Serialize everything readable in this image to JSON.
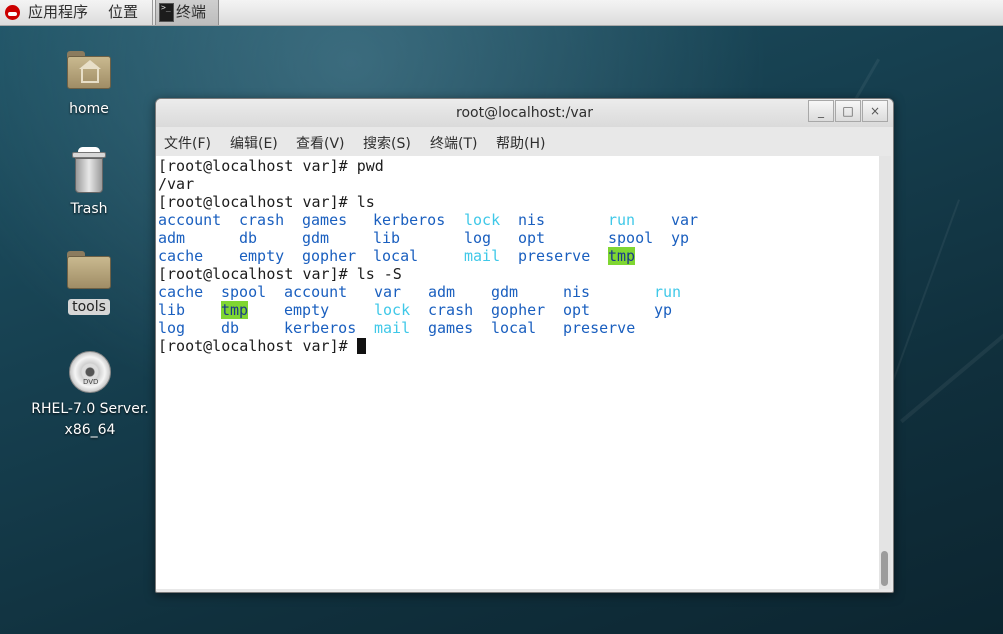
{
  "top_panel": {
    "applications": "应用程序",
    "places": "位置",
    "task_terminal": "终端",
    "term_icon_glyph": ">_"
  },
  "desktop": {
    "home": "home",
    "trash": "Trash",
    "tools": "tools",
    "dvd_line1": "RHEL-7.0 Server.",
    "dvd_line2": "x86_64",
    "dvd_badge": "DVD"
  },
  "window": {
    "title": "root@localhost:/var",
    "minimize": "_",
    "maximize": "□",
    "close": "×",
    "menu": [
      "文件(F)",
      "编辑(E)",
      "查看(V)",
      "搜索(S)",
      "终端(T)",
      "帮助(H)"
    ]
  },
  "terminal": {
    "prompt": "[root@localhost var]# ",
    "cmd1": "pwd",
    "out1": "/var",
    "cmd2": "ls",
    "ls_rows": [
      [
        "account",
        "crash",
        "games",
        "kerberos",
        "lock",
        "nis",
        "run",
        "var"
      ],
      [
        "adm",
        "db",
        "gdm",
        "lib",
        "log",
        "opt",
        "spool",
        "yp"
      ],
      [
        "cache",
        "empty",
        "gopher",
        "local",
        "mail",
        "preserve",
        "tmp"
      ]
    ],
    "cmd3": "ls -S",
    "lsS_rows": [
      [
        "cache",
        "spool",
        "account",
        "var",
        "adm",
        "gdm",
        "nis",
        "run"
      ],
      [
        "lib",
        "tmp",
        "empty",
        "lock",
        "crash",
        "gopher",
        "opt",
        "yp"
      ],
      [
        "log",
        "db",
        "kerberos",
        "mail",
        "games",
        "local",
        "preserve"
      ]
    ]
  },
  "colors": {
    "dir": "#1a5fbf",
    "symlink": "#3fc8e8",
    "sticky_bg": "#7fd632"
  }
}
